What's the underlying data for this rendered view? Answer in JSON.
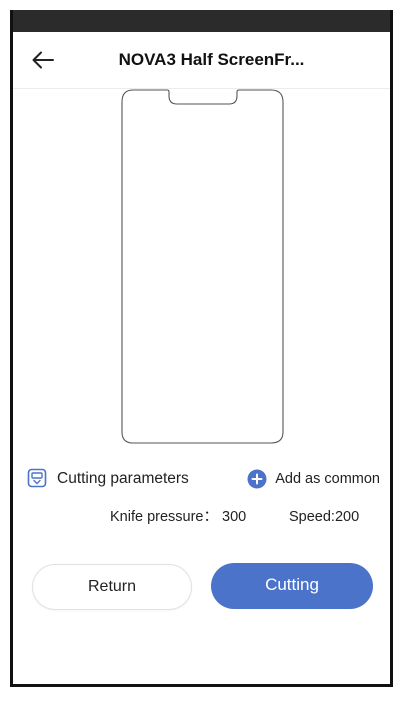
{
  "header": {
    "title": "NOVA3 Half ScreenFr..."
  },
  "params": {
    "label": "Cutting parameters",
    "add_common_label": "Add as common",
    "knife_pressure_label": "Knife pressure：",
    "knife_pressure_value": "300",
    "speed_label": "Speed:",
    "speed_value": "200"
  },
  "actions": {
    "return_label": "Return",
    "cutting_label": "Cutting"
  },
  "colors": {
    "accent": "#4b73c9",
    "status_bar": "#2b2b2b"
  },
  "icons": {
    "back": "arrow-left-icon",
    "params": "cutter-device-icon",
    "add": "plus-circle-icon"
  }
}
